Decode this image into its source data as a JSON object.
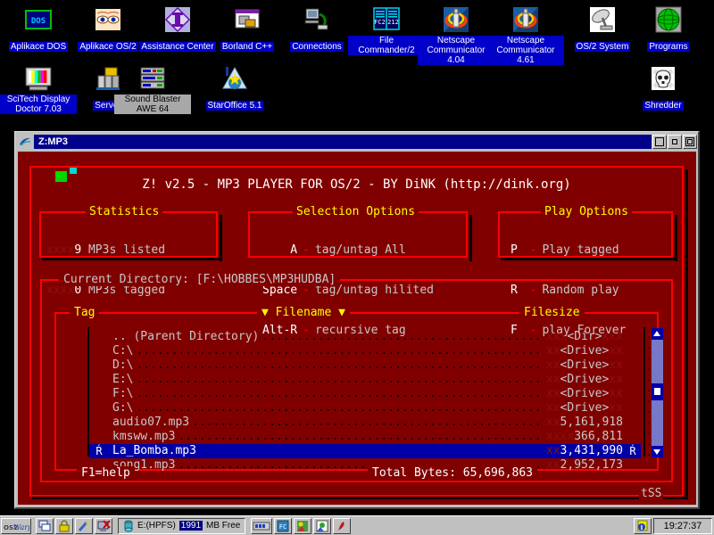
{
  "desktop": {
    "icons_row1": [
      {
        "label": "Aplikace DOS",
        "icon": "dos-box-icon",
        "style": "blue"
      },
      {
        "label": "Aplikace OS/2",
        "icon": "eyes-icon",
        "style": "blue"
      },
      {
        "label": "Assistance Center",
        "icon": "assistance-diamond-icon",
        "style": "blue"
      },
      {
        "label": "Borland C++",
        "icon": "borland-windows-icon",
        "style": "blue"
      },
      {
        "label": "Connections",
        "icon": "computer-network-icon",
        "style": "blue"
      },
      {
        "label": "File Commander/2",
        "icon": "file-commander-icon",
        "style": "blue"
      },
      {
        "label": "Netscape Communicator 4.04",
        "icon": "netscape-icon",
        "style": "blue"
      },
      {
        "label": "Netscape Communicator 4.61",
        "icon": "netscape-icon",
        "style": "blue"
      },
      {
        "label": "OS/2 System",
        "icon": "satellite-dish-icon",
        "style": "blue"
      },
      {
        "label": "Programs",
        "icon": "green-globe-icon",
        "style": "blue"
      }
    ],
    "icons_row2": [
      {
        "label": "SciTech Display Doctor 7.03",
        "icon": "monitor-colorbars-icon",
        "style": "blue"
      },
      {
        "label": "Server",
        "icon": "server-tower-icon",
        "style": "blue"
      },
      {
        "label": "Sound Blaster AWE 64",
        "icon": "rack-audio-icon",
        "style": "grey"
      },
      {
        "label": "StarOffice 5.1",
        "icon": "staroffice-globe-icon",
        "style": "blue"
      },
      {
        "label": "Shredder",
        "icon": "skull-crossbones-icon",
        "style": "blue"
      }
    ]
  },
  "window": {
    "title": "Z:MP3",
    "sysmenu_icon": "os2-sysmenu-icon",
    "buttons": [
      {
        "name": "hide-button",
        "icon": "hide-icon"
      },
      {
        "name": "minimize-button",
        "icon": "minimize-icon"
      },
      {
        "name": "maximize-button",
        "icon": "maximize-icon"
      }
    ]
  },
  "app": {
    "banner": "Z! v2.5 - MP3 PLAYER FOR OS/2 - BY DiNK (http://dink.org)",
    "statistics": {
      "title": "Statistics",
      "rows": [
        {
          "pad": "xxxx",
          "value": "9",
          "text": " MP3s listed"
        },
        {
          "pad": "xxxx",
          "value": "0",
          "text": " MP3s tagged"
        }
      ]
    },
    "selection_options": {
      "title": "Selection Options",
      "rows": [
        {
          "key": "A",
          "sep": "-",
          "desc": "tag/untag All"
        },
        {
          "key": "Space",
          "sep": "-",
          "desc": "tag/untag hilited"
        },
        {
          "key": "Alt-R",
          "sep": "-",
          "desc": "recursive tag"
        }
      ]
    },
    "play_options": {
      "title": "Play Options",
      "rows": [
        {
          "key": "P",
          "sep": "-",
          "desc": "Play tagged"
        },
        {
          "key": "R",
          "sep": "-",
          "desc": "Random play"
        },
        {
          "key": "F",
          "sep": "-",
          "desc": "play Forever"
        }
      ]
    },
    "current_directory_label": "Current Directory: [F:\\HOBBES\\MP3HUDBA]",
    "columns": {
      "tag": "Tag",
      "filename": "Filename",
      "filename_caret_left": "▼",
      "filename_caret_right": "▼",
      "filesize": "Filesize"
    },
    "files": [
      {
        "tag": "",
        "name": ".. (Parent Directory)",
        "size": "<Dir>",
        "size_pad_left": "xxx",
        "size_pad_right": "xxx",
        "selected": false,
        "endtag": ""
      },
      {
        "tag": "",
        "name": "C:\\",
        "size": "<Drive>",
        "size_pad_left": "xx",
        "size_pad_right": "xx",
        "selected": false,
        "endtag": ""
      },
      {
        "tag": "",
        "name": "D:\\",
        "size": "<Drive>",
        "size_pad_left": "xx",
        "size_pad_right": "xx",
        "selected": false,
        "endtag": ""
      },
      {
        "tag": "",
        "name": "E:\\",
        "size": "<Drive>",
        "size_pad_left": "xx",
        "size_pad_right": "xx",
        "selected": false,
        "endtag": ""
      },
      {
        "tag": "",
        "name": "F:\\",
        "size": "<Drive>",
        "size_pad_left": "xx",
        "size_pad_right": "xx",
        "selected": false,
        "endtag": ""
      },
      {
        "tag": "",
        "name": "G:\\",
        "size": "<Drive>",
        "size_pad_left": "xx",
        "size_pad_right": "xx",
        "selected": false,
        "endtag": ""
      },
      {
        "tag": "",
        "name": "audio07.mp3",
        "size": "5,161,918",
        "size_pad_left": "xx",
        "size_pad_right": "",
        "selected": false,
        "endtag": ""
      },
      {
        "tag": "",
        "name": "kmsww.mp3",
        "size": "366,811",
        "size_pad_left": "xxxx",
        "size_pad_right": "",
        "selected": false,
        "endtag": ""
      },
      {
        "tag": "Ŕ",
        "name": "La_Bomba.mp3",
        "size": "3,431,990",
        "size_pad_left": "xx",
        "size_pad_right": "",
        "selected": true,
        "endtag": "Ŕ"
      },
      {
        "tag": "",
        "name": "song1.mp3",
        "size": "2,952,173",
        "size_pad_left": "xx",
        "size_pad_right": "",
        "selected": false,
        "endtag": ""
      }
    ],
    "footer": {
      "help": "F1=help",
      "total_bytes": "Total Bytes: 65,696,863",
      "corner": "tSS"
    },
    "scrollbar": {
      "up_icon": "scroll-up-arrow-icon",
      "down_icon": "scroll-down-arrow-icon",
      "thumb_icon": "scroll-thumb"
    }
  },
  "taskbar": {
    "start_label": "OS/2 Warp",
    "buttons": [
      {
        "name": "window-list-button",
        "icon": "cascade-windows-icon"
      },
      {
        "name": "lockup-button",
        "icon": "padlock-icon"
      },
      {
        "name": "marker-button",
        "icon": "pen-icon"
      },
      {
        "name": "shutdown-button",
        "icon": "shutdown-monitor-icon"
      }
    ],
    "drive": {
      "icon": "drive-icon",
      "label": "E:(HPFS)",
      "free_amount": "1991",
      "free_unit": "MB Free"
    },
    "tray_buttons": [
      {
        "name": "memory-meter-button",
        "icon": "memory-meter-icon"
      },
      {
        "name": "fc2-button",
        "icon": "fc2-icon"
      },
      {
        "name": "paint-button",
        "icon": "paint-icon"
      },
      {
        "name": "image-button",
        "icon": "photo-icon"
      },
      {
        "name": "acrobat-button",
        "icon": "acrobat-icon"
      },
      {
        "name": "info-button",
        "icon": "info-note-icon"
      }
    ],
    "clock": "19:27:37"
  },
  "colors": {
    "console_bg": "#800000",
    "frame_red": "#ff0000",
    "title_yellow": "#ffff00",
    "select_blue": "#0000a8",
    "desktop_bg": "#000000",
    "chrome": "#c0c0c0"
  }
}
